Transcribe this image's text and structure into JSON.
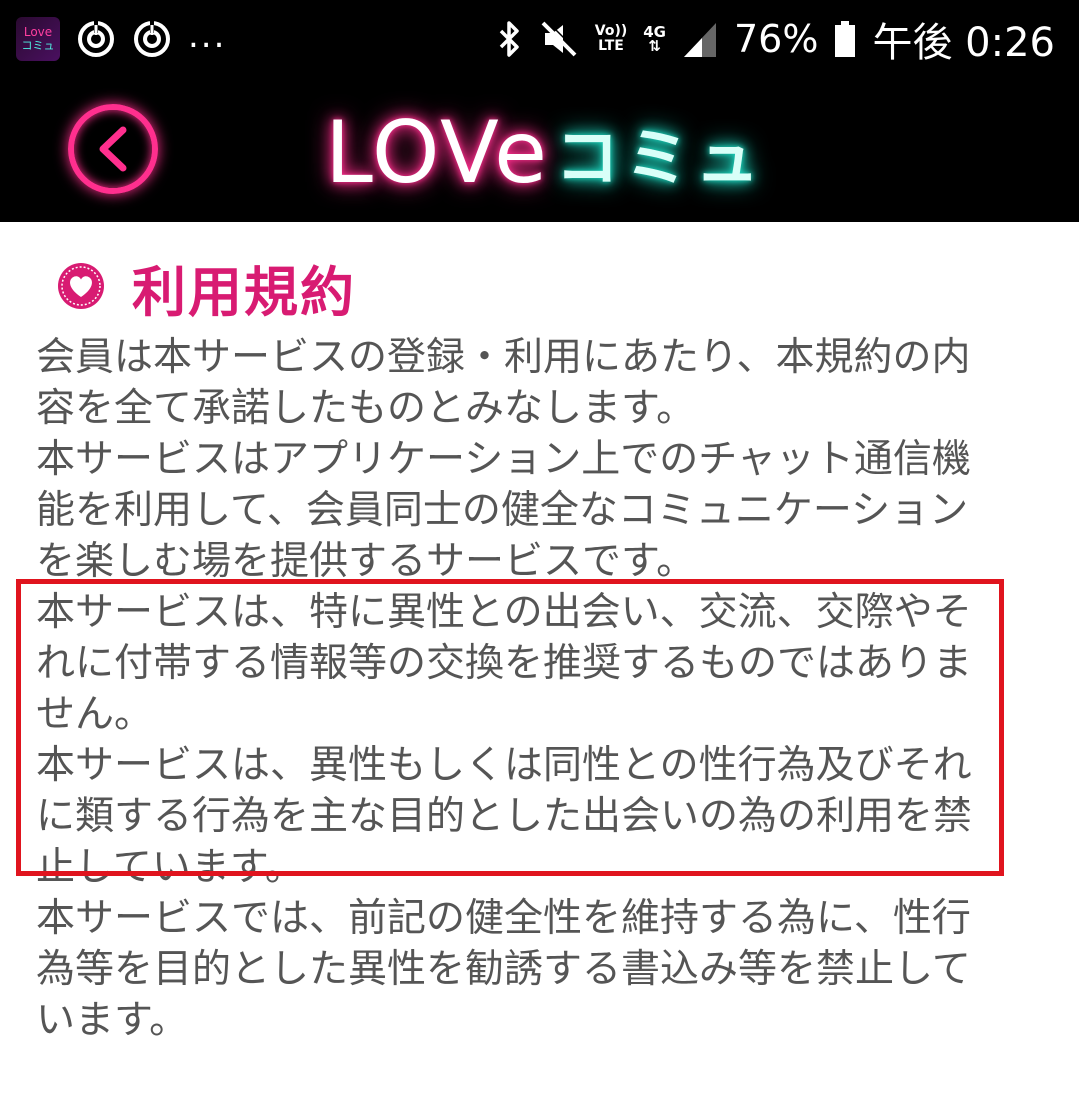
{
  "status_bar": {
    "app_icon_line1": "Love",
    "app_icon_line2": "コミュ",
    "overflow": "...",
    "volte_top": "Vo))",
    "volte_bottom": "LTE",
    "network_type": "4G",
    "battery_percent": "76%",
    "clock": "午後 0:26"
  },
  "header": {
    "logo_love": "LOVe",
    "logo_comu": "コミュ"
  },
  "page": {
    "title": "利用規約",
    "paragraphs": [
      "会員は本サービスの登録・利用にあたり、本規約の内容を全て承諾したものとみなします。",
      "本サービスはアプリケーション上でのチャット通信機能を利用して、会員同士の健全なコミュニケーションを楽しむ場を提供するサービスです。",
      "本サービスは、特に異性との出会い、交流、交際やそれに付帯する情報等の交換を推奨するものではありません。",
      "本サービスは、異性もしくは同性との性行為及びそれに類する行為を主な目的とした出会いの為の利用を禁止しています。",
      "本サービスでは、前記の健全性を維持する為に、性行為等を目的とした異性を勧誘する書込み等を禁止しています。"
    ]
  },
  "colors": {
    "accent_pink": "#d81b72",
    "neon_pink": "#ff2f8e",
    "neon_teal": "#1fe0c8",
    "highlight_red": "#e0141e",
    "body_text": "#555555"
  }
}
